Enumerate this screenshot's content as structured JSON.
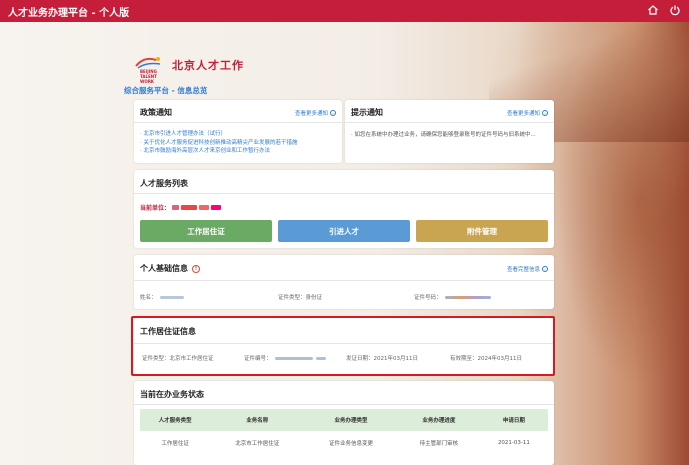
{
  "app": {
    "title": "人才业务办理平台 - 个人版",
    "icons": [
      "home-icon",
      "power-icon"
    ]
  },
  "logo": {
    "cn_text": "北京人才工作",
    "en_text": "BEIJING TALENT WORK"
  },
  "breadcrumb": "综合服务平台 - 信息总览",
  "policy": {
    "title": "政策通知",
    "more": "查看更多通知",
    "items": [
      "· 北京市引进人才管理办法（试行）",
      "· 关于优化人才服务促进科技创新推动高精尖产业发展的若干措施",
      "· 北京市鼓励海外高层次人才来京创业和工作暂行办法"
    ]
  },
  "hint": {
    "title": "提示通知",
    "more": "查看更多通知",
    "text": "· 如您在系统中办理过业务，请确保您能够登录账号的证件号码与旧系统中..."
  },
  "services": {
    "title": "人才服务列表",
    "unit_label": "当前单位：",
    "buttons": [
      "工作居住证",
      "引进人才",
      "附件管理"
    ],
    "colors": [
      "#6aaa64",
      "#5a9bd5",
      "#c9a552"
    ]
  },
  "personal": {
    "title": "个人基础信息",
    "more": "查看完整信息",
    "name_label": "姓名：",
    "idtype_label": "证件类型：身份证",
    "idnum_label": "证件号码："
  },
  "permit": {
    "title": "工作居住证信息",
    "type": "证件类型：北京市工作居住证",
    "number_label": "证件编号：",
    "issue": "发证日期：2021年03月11日",
    "valid": "有效期至：2024年03月11日"
  },
  "status": {
    "title": "当前在办业务状态",
    "headers": [
      "人才服务类型",
      "业务名称",
      "业务办理类型",
      "业务办理进度",
      "申请日期"
    ],
    "rows": [
      [
        "工作居住证",
        "北京市工作居住证",
        "证件业务信息变更",
        "待主管部门审核",
        "2021-03-11"
      ]
    ]
  },
  "colors": {
    "brand_red": "#c41e3a",
    "link_blue": "#2f7bd4",
    "highlight_red": "#d71920"
  }
}
